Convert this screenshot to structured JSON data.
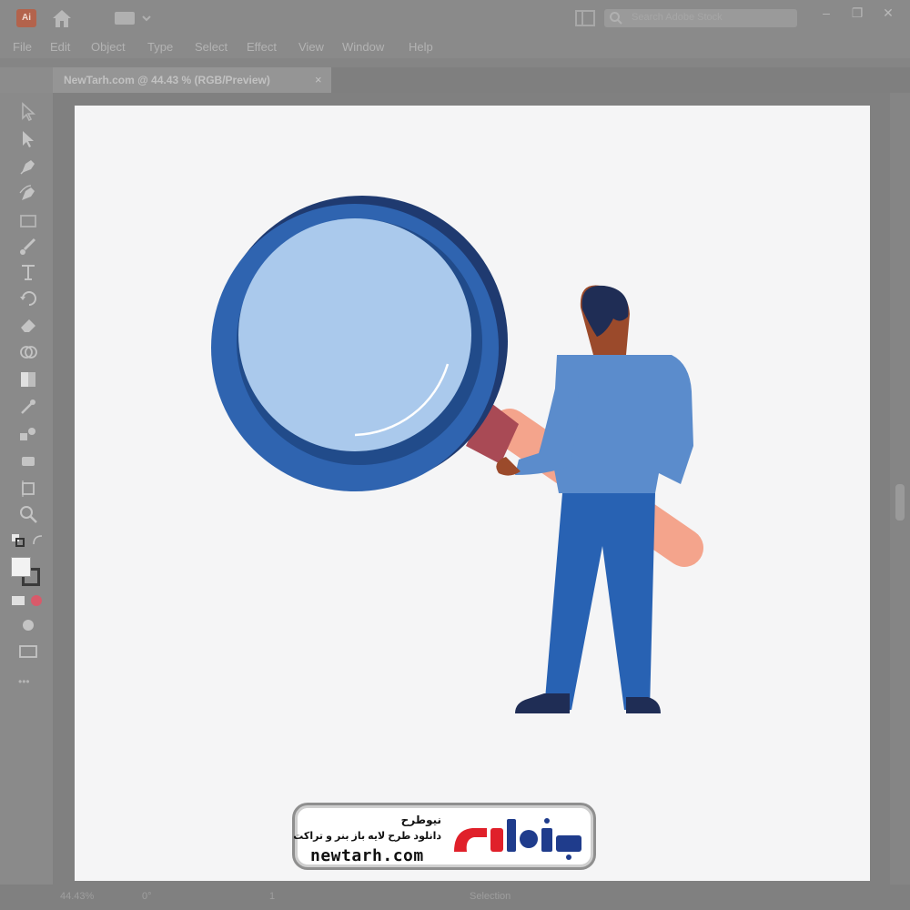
{
  "app": {
    "logo_text": "Ai",
    "search_placeholder": "Search Adobe Stock",
    "window_controls": [
      "–",
      "❐",
      "✕"
    ]
  },
  "menu": [
    "File",
    "Edit",
    "Object",
    "Type",
    "Select",
    "Effect",
    "View",
    "Window",
    "Help"
  ],
  "document": {
    "tab_title": "NewTarh.com @ 44.43 % (RGB/Preview)",
    "close_glyph": "×"
  },
  "toolbar": {
    "tools": [
      "selection-tool",
      "direct-selection-tool",
      "pen-tool",
      "curvature-tool",
      "rectangle-tool",
      "paintbrush-tool",
      "type-tool",
      "rotate-tool",
      "eraser-tool",
      "shape-builder-tool",
      "gradient-tool",
      "eyedropper-tool",
      "blend-tool",
      "symbol-sprayer-tool",
      "artboard-tool",
      "zoom-tool"
    ],
    "more_glyph": "•••"
  },
  "status": {
    "zoom": "44.43%",
    "rotation": "0°",
    "artboard": "1",
    "tool": "Selection"
  },
  "watermark": {
    "title": "نیوطرح",
    "subtitle": "دانلود طرح لایه باز بنر و تراکت",
    "url": "newtarh.com",
    "logo_text": "نیوطرح"
  },
  "colors": {
    "lens_rim_dark": "#1f3a70",
    "lens_rim": "#2f64b0",
    "lens_glass": "#aac9ec",
    "handle_collar": "#a94a55",
    "handle": "#f4a48c",
    "shirt": "#5b8ccc",
    "pants": "#2862b3",
    "hair": "#1f2d55",
    "skin": "#9b4a2b",
    "logo_red": "#e0202a",
    "logo_blue": "#1f3c8c"
  }
}
